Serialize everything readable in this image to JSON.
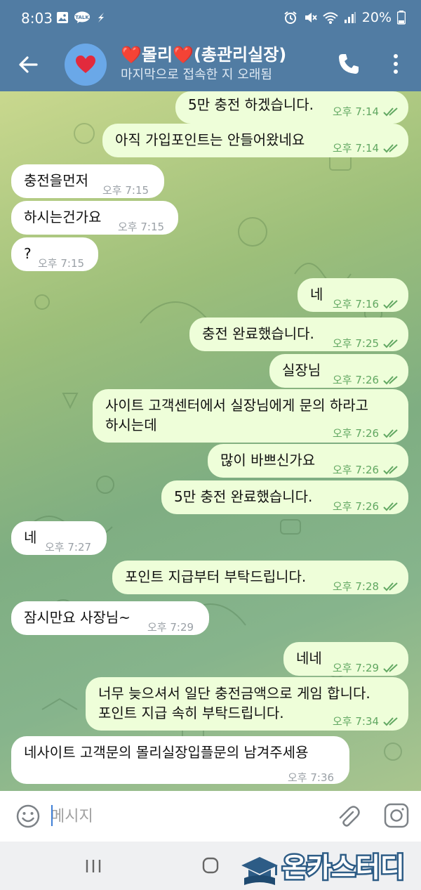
{
  "status_bar": {
    "time": "8:03",
    "battery": "20%"
  },
  "header": {
    "title": "❤️몰리❤️(총관리실장)",
    "subtitle": "마지막으로 접속한 지 오래됨"
  },
  "messages": [
    {
      "dir": "out",
      "text": "5만 충전 하겠습니다.",
      "time": "오후 7:14",
      "read": true
    },
    {
      "dir": "out",
      "text": "아직 가입포인트는 안들어왔네요",
      "time": "오후 7:14",
      "read": true
    },
    {
      "dir": "in",
      "text": "충전을먼저",
      "time": "오후 7:15"
    },
    {
      "dir": "in",
      "text": "하시는건가요",
      "time": "오후 7:15"
    },
    {
      "dir": "in",
      "text": "?",
      "time": "오후 7:15"
    },
    {
      "dir": "out",
      "text": "네",
      "time": "오후 7:16",
      "read": true
    },
    {
      "dir": "out",
      "text": "충전 완료했습니다.",
      "time": "오후 7:25",
      "read": true
    },
    {
      "dir": "out",
      "text": "실장님",
      "time": "오후 7:26",
      "read": true
    },
    {
      "dir": "out",
      "text": "사이트 고객센터에서 실장님에게 문의 하라고",
      "text2": "하시는데",
      "time": "오후 7:26",
      "read": true
    },
    {
      "dir": "out",
      "text": "많이 바쁘신가요",
      "time": "오후 7:26",
      "read": true
    },
    {
      "dir": "out",
      "text": "5만 충전 완료했습니다.",
      "time": "오후 7:26",
      "read": true
    },
    {
      "dir": "in",
      "text": "네",
      "time": "오후 7:27"
    },
    {
      "dir": "out",
      "text": "포인트 지급부터 부탁드립니다.",
      "time": "오후 7:28",
      "read": true
    },
    {
      "dir": "in",
      "text": "잠시만요 사장님~",
      "time": "오후 7:29"
    },
    {
      "dir": "out",
      "text": "네네",
      "time": "오후 7:29",
      "read": true
    },
    {
      "dir": "out",
      "text": "너무 늦으셔서 일단 충전금액으로 게임 합니다.",
      "text2": "포인트 지급 속히 부탁드립니다.",
      "time": "오후 7:34",
      "read": true
    },
    {
      "dir": "in",
      "text": "네사이트 고객문의 몰리실장입플문의 남겨주세용",
      "time": "오후 7:36"
    }
  ],
  "input": {
    "placeholder": "메시지"
  },
  "watermark": {
    "text": "온카스터디"
  },
  "colors": {
    "header": "#517ca3",
    "bubble_out": "#eefed9",
    "bubble_in": "#ffffff",
    "check": "#62a862"
  }
}
